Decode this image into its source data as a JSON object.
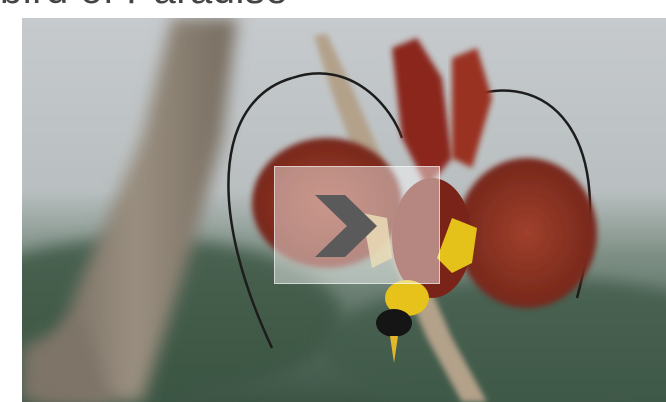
{
  "page": {
    "heading_fragment": "bird of Paradise"
  },
  "carousel": {
    "image_alt": "",
    "next_icon": "chevron-right-icon",
    "colors": {
      "sky": "#c9cdd0",
      "foliage": "#3f5a47",
      "branch": "#b7a58e",
      "plumage_red": "#8e2a1e",
      "plumage_yellow": "#e6c21a",
      "chevron": "#5a5a5a"
    }
  }
}
